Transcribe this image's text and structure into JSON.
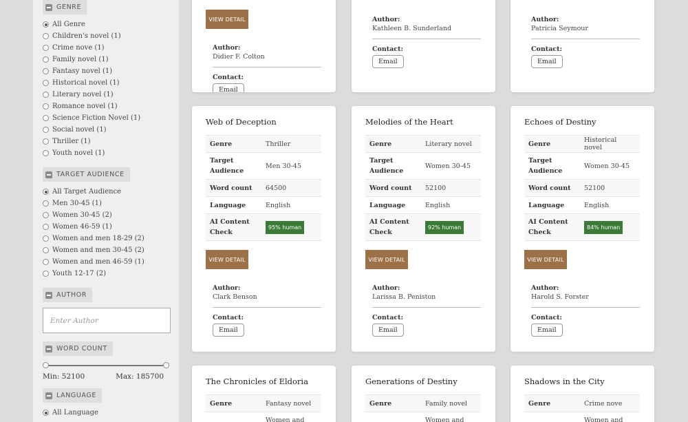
{
  "sidebar": {
    "genre": {
      "heading": "GENRE",
      "items": [
        {
          "label": "All Genre",
          "checked": true
        },
        {
          "label": "Children's novel (1)"
        },
        {
          "label": "Crime nove (1)"
        },
        {
          "label": "Family novel (1)"
        },
        {
          "label": "Fantasy novel (1)"
        },
        {
          "label": "Historical novel (1)"
        },
        {
          "label": "Literary novel (1)"
        },
        {
          "label": "Romance novel (1)"
        },
        {
          "label": "Science Fiction Novel (1)"
        },
        {
          "label": "Social novel (1)"
        },
        {
          "label": "Thriller (1)"
        },
        {
          "label": "Youth novel (1)"
        }
      ]
    },
    "audience": {
      "heading": "TARGET AUDIENCE",
      "items": [
        {
          "label": "All Target Audience",
          "checked": true
        },
        {
          "label": "Men 30-45 (1)"
        },
        {
          "label": "Women 30-45 (2)"
        },
        {
          "label": "Women 46-59 (1)"
        },
        {
          "label": "Women and men 18-29 (2)"
        },
        {
          "label": "Women and men 30-45 (2)"
        },
        {
          "label": "Women and men 46-59 (1)"
        },
        {
          "label": "Youth 12-17 (2)"
        }
      ]
    },
    "author": {
      "heading": "AUTHOR",
      "placeholder": "Enter Author"
    },
    "word_count": {
      "heading": "WORD COUNT",
      "min_label": "Min: 52100",
      "max_label": "Max: 185700"
    },
    "language": {
      "heading": "LANGUAGE",
      "items": [
        {
          "label": "All Language",
          "checked": true
        }
      ]
    }
  },
  "labels": {
    "genre": "Genre",
    "target": "Target",
    "audience": "Audience",
    "word_count": "Word count",
    "language": "Language",
    "ai_content": "AI Content",
    "check": "Check",
    "view_detail": "VIEW DETAIL",
    "author": "Author:",
    "contact": "Contact:",
    "email": "Email"
  },
  "top_cards": [
    {
      "author": "Didier F. Colton"
    },
    {
      "author": "Kathleen B. Sunderland"
    },
    {
      "author": "Patricia Seymour"
    }
  ],
  "cards": [
    {
      "title": "Web of Deception",
      "genre": "Thriller",
      "audience": "Men 30-45",
      "word_count": "64500",
      "language": "English",
      "ai": "95% human",
      "author": "Clark Benson"
    },
    {
      "title": "Melodies of the Heart",
      "genre": "Literary novel",
      "audience": "Women 30-45",
      "word_count": "52100",
      "language": "English",
      "ai": "92% human",
      "author": "Larissa B. Peniston"
    },
    {
      "title": "Echoes of Destiny",
      "genre": "Historical novel",
      "audience": "Women 30-45",
      "word_count": "52100",
      "language": "English",
      "ai": "84% human",
      "author": "Harold S. Forster"
    }
  ],
  "bottom_cards": [
    {
      "title": "The Chronicles of Eldoria",
      "genre": "Fantasy novel",
      "audience_partial": "Women and men"
    },
    {
      "title": "Generations of Destiny",
      "genre": "Family novel",
      "audience_partial": "Women and men"
    },
    {
      "title": "Shadows in the City",
      "genre": "Crime nove",
      "audience_partial": "Women and men"
    }
  ],
  "colors": {
    "accent": "#9c7148",
    "ai_badge": "#3c7a37",
    "page_bg": "#dcdcdc",
    "sidebar_bg": "#efefef"
  }
}
